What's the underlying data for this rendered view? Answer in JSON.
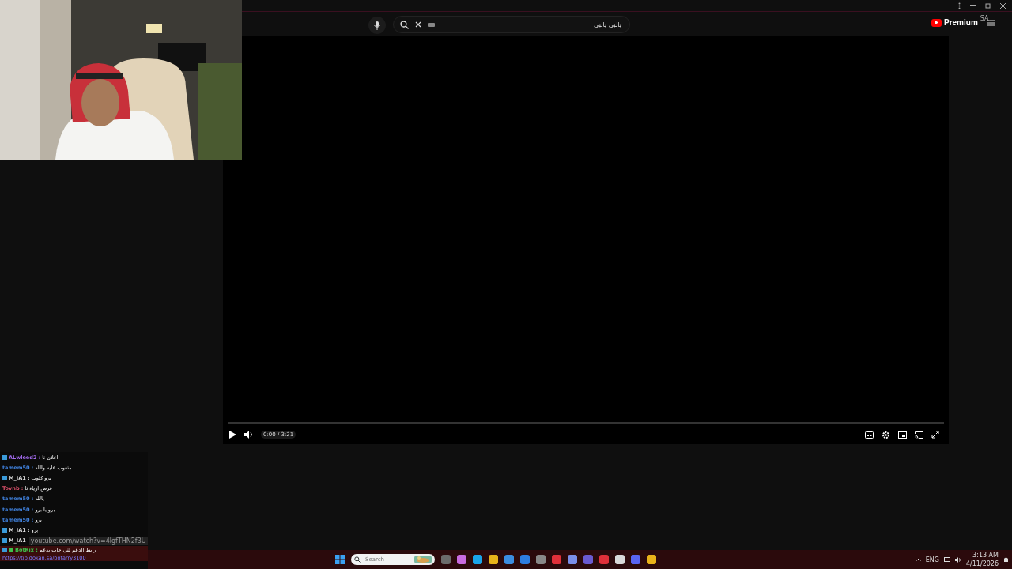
{
  "header": {
    "search": {
      "value": "يالبي يالبي"
    },
    "logo": "Premium",
    "region": "SA"
  },
  "player": {
    "progress": {
      "level": 0
    },
    "time": "0:00 / 3:21"
  },
  "chat": {
    "separator": ":",
    "messages": [
      {
        "user": "ALwleed2",
        "color": "#a46cf0",
        "badge": true,
        "text": "اعلان تا"
      },
      {
        "user": "tamem50",
        "color": "#3f7fd9",
        "badge": false,
        "text": "متعوب عليه والله"
      },
      {
        "user": "M_IA1",
        "color": "#e0e0e0",
        "badge": true,
        "text": "برو كلوب"
      },
      {
        "user": "Tovnb",
        "color": "#d9506a",
        "badge": false,
        "text": "عرض ازياء تا"
      },
      {
        "user": "tamem50",
        "color": "#3f7fd9",
        "badge": false,
        "text": "يالله"
      },
      {
        "user": "tamem50",
        "color": "#3f7fd9",
        "badge": false,
        "text": "برو يا برو"
      },
      {
        "user": "tamem50",
        "color": "#3f7fd9",
        "badge": false,
        "text": "برو"
      },
      {
        "user": "M_IA1",
        "color": "#e0e0e0",
        "badge": true,
        "text": "برو"
      }
    ],
    "covered": {
      "user": "M_IA1",
      "color": "#e0e0e0",
      "badge": true,
      "tooltip": "youtube.com/watch?v=4lgfTHN2f3U"
    },
    "bot": {
      "user": "BotRix",
      "color": "#3fc24a",
      "text": "رابط الدعم لتي حاب يدعم",
      "link": "https://tip.dokan.sa/botarry3100"
    }
  },
  "taskbar": {
    "search": {
      "placeholder": "Search"
    },
    "time": "3:13 AM",
    "date": "4/11/2026",
    "language": "ENG"
  }
}
